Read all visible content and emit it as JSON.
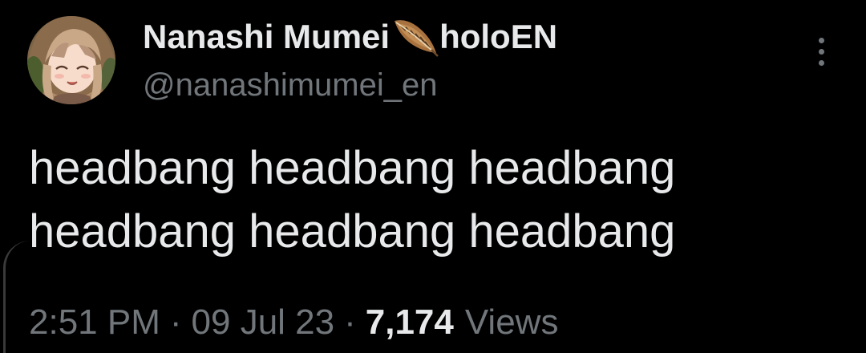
{
  "author": {
    "display_name": "Nanashi Mumei",
    "badge_icon": "feather-icon",
    "affiliation": "holoEN",
    "handle": "@nanashimumei_en",
    "avatar_icon": "avatar-image"
  },
  "tweet": {
    "lines": [
      "headbang headbang headbang",
      "headbang headbang headbang"
    ]
  },
  "meta": {
    "time": "2:51 PM",
    "separator": "·",
    "date": "09 Jul 23",
    "views_count": "7,174",
    "views_label": "Views"
  },
  "menu": {
    "more_icon": "more-options-icon"
  },
  "colors": {
    "background": "#000000",
    "primary_text": "#e7e9ea",
    "secondary_text": "#71767b"
  }
}
